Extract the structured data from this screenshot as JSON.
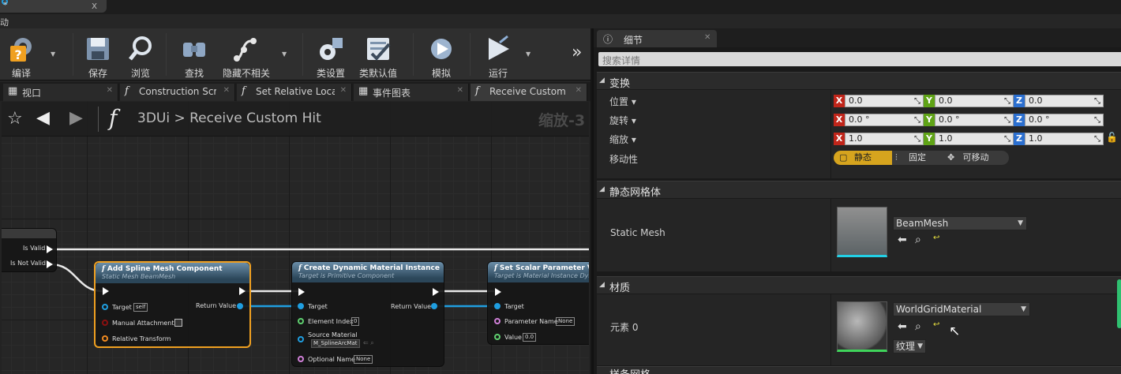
{
  "window": {
    "tab_title": "*",
    "tab_close": "x",
    "menu_label": "动"
  },
  "toolbar": {
    "buttons": [
      {
        "label": "编译",
        "icon": "compile-icon"
      },
      {
        "label": "保存",
        "icon": "save-icon"
      },
      {
        "label": "浏览",
        "icon": "browse-icon"
      },
      {
        "label": "查找",
        "icon": "find-icon"
      },
      {
        "label": "隐藏不相关",
        "icon": "hide-unrelated-icon"
      },
      {
        "label": "类设置",
        "icon": "class-settings-icon"
      },
      {
        "label": "类默认值",
        "icon": "class-defaults-icon"
      },
      {
        "label": "模拟",
        "icon": "simulate-icon"
      },
      {
        "label": "运行",
        "icon": "play-icon"
      }
    ],
    "more": "»"
  },
  "doc_tabs": [
    {
      "label": "视口",
      "icon": "viewport-icon"
    },
    {
      "label": "Construction Scrip",
      "icon": "function-icon"
    },
    {
      "label": "Set Relative  Loca",
      "icon": "function-icon"
    },
    {
      "label": "事件图表",
      "icon": "event-graph-icon"
    },
    {
      "label": "Receive Custom H",
      "icon": "function-icon"
    }
  ],
  "graph": {
    "breadcrumb": "3DUi > Receive Custom Hit",
    "zoom": "缩放-3",
    "branch": {
      "is_valid": "Is Valid",
      "is_not_valid": "Is Not Valid"
    },
    "nodes": {
      "add_spline": {
        "title": "Add Spline Mesh Component",
        "subtitle": "Static Mesh BeamMesh",
        "target": "Target",
        "target_value": "self",
        "manual_attachment": "Manual Attachment",
        "relative_transform": "Relative Transform",
        "return_value": "Return Value"
      },
      "create_dmi": {
        "title": "Create Dynamic Material Instance",
        "subtitle": "Target is Primitive Component",
        "target": "Target",
        "return_value": "Return Value",
        "element_index": "Element Index",
        "element_index_value": "0",
        "source_material": "Source Material",
        "source_material_value": "M_SplineArcMat",
        "optional_name": "Optional Name",
        "optional_name_value": "None"
      },
      "set_scalar": {
        "title": "Set Scalar Parameter Value",
        "subtitle": "Target is Material Instance Dyn",
        "target": "Target",
        "parameter_name": "Parameter Name",
        "parameter_name_value": "None",
        "value": "Value",
        "value_value": "0.0"
      }
    }
  },
  "details": {
    "tab_label": "细节",
    "search_placeholder": "搜索详情",
    "transform": {
      "section": "变换",
      "location": {
        "label": "位置",
        "x": "0.0",
        "y": "0.0",
        "z": "0.0"
      },
      "rotation": {
        "label": "旋转",
        "x": "0.0 °",
        "y": "0.0 °",
        "z": "0.0 °"
      },
      "scale": {
        "label": "缩放",
        "x": "1.0",
        "y": "1.0",
        "z": "1.0"
      },
      "mobility": {
        "label": "移动性",
        "static": "静态",
        "stationary": "固定",
        "movable": "可移动"
      },
      "axis_x": "X",
      "axis_y": "Y",
      "axis_z": "Z"
    },
    "static_mesh": {
      "section": "静态网格体",
      "label": "Static Mesh",
      "value": "BeamMesh"
    },
    "materials": {
      "section": "材质",
      "label": "元素 0",
      "value": "WorldGridMaterial",
      "texture_button": "纹理"
    },
    "next_section": "样条网格"
  },
  "colors": {
    "accent": "#f0a020",
    "exec": "#ffffff",
    "object_pin": "#1f9ee0",
    "axis_x": "#c0251a",
    "axis_y": "#5fa316",
    "axis_z": "#2b6fd0"
  }
}
